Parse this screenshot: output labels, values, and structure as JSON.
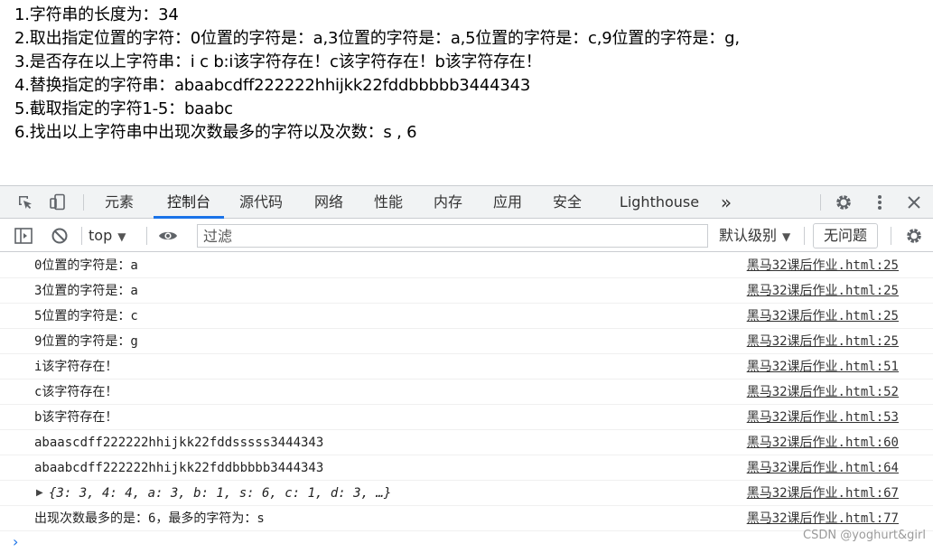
{
  "page_output": [
    "1.字符串的长度为：34",
    "2.取出指定位置的字符：0位置的字符是：a,3位置的字符是：a,5位置的字符是：c,9位置的字符是：g,",
    "3.是否存在以上字符串：i c b:i该字符存在！c该字符存在！b该字符存在！",
    "4.替换指定的字符串：abaabcdff222222hhijkk22fddbbbbb3444343",
    "5.截取指定的字符1-5：baabc",
    "6.找出以上字符串中出现次数最多的字符以及次数：s , 6"
  ],
  "devtools": {
    "tabs": [
      "元素",
      "控制台",
      "源代码",
      "网络",
      "性能",
      "内存",
      "应用",
      "安全",
      "Lighthouse",
      "»"
    ],
    "active_tab": "控制台",
    "toolbar": {
      "context": "top",
      "filter_placeholder": "过滤",
      "levels": "默认级别",
      "issues": "无问题"
    },
    "messages": [
      {
        "text": "0位置的字符是：a",
        "source": "黑马32课后作业.html:25"
      },
      {
        "text": "3位置的字符是：a",
        "source": "黑马32课后作业.html:25"
      },
      {
        "text": "5位置的字符是：c",
        "source": "黑马32课后作业.html:25"
      },
      {
        "text": "9位置的字符是：g",
        "source": "黑马32课后作业.html:25"
      },
      {
        "text": "i该字符存在！",
        "source": "黑马32课后作业.html:51"
      },
      {
        "text": "c该字符存在！",
        "source": "黑马32课后作业.html:52"
      },
      {
        "text": "b该字符存在！",
        "source": "黑马32课后作业.html:53"
      },
      {
        "text": "abaascdff222222hhijkk22fddsssss3444343",
        "source": "黑马32课后作业.html:60"
      },
      {
        "text": "abaabcdff222222hhijkk22fddbbbbb3444343",
        "source": "黑马32课后作业.html:64"
      },
      {
        "text": "{3: 3, 4: 4, a: 3, b: 1, s: 6, c: 1, d: 3, …}",
        "source": "黑马32课后作业.html:67"
      },
      {
        "text": "出现次数最多的是：6，最多的字符为：s",
        "source": "黑马32课后作业.html:77"
      }
    ],
    "prompt": "›"
  },
  "watermark": "CSDN @yoghurt&girl",
  "colors": {
    "accent": "#1a73e8",
    "number": "#1c00cf"
  }
}
